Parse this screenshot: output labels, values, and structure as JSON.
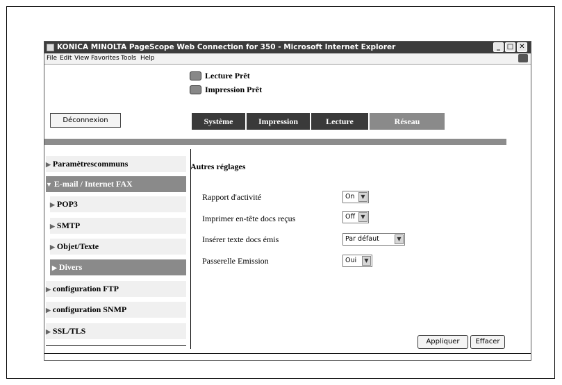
{
  "window": {
    "title": "KONICA MINOLTA PageScope Web Connection for 350 - Microsoft Internet Explorer",
    "controls": {
      "minimize": "_",
      "maximize": "□",
      "close": "✕"
    }
  },
  "menu": [
    "File",
    "Edit",
    "View",
    "Favorites",
    "Tools",
    "Help"
  ],
  "status": {
    "scan": "Lecture Prêt",
    "print": "Impression Prêt"
  },
  "logout_label": "Déconnexion",
  "tabs": [
    {
      "label": "Système",
      "active": true
    },
    {
      "label": "Impression",
      "active": true
    },
    {
      "label": "Lecture",
      "active": true
    },
    {
      "label": "Réseau",
      "active": false
    }
  ],
  "sidebar": {
    "items": [
      {
        "label": "Paramètrescommuns",
        "arrow": "▶"
      },
      {
        "label": "E-mail / Internet FAX",
        "arrow": "▼"
      },
      {
        "label": "POP3",
        "arrow": "▶"
      },
      {
        "label": "SMTP",
        "arrow": "▶"
      },
      {
        "label": "Objet/Texte",
        "arrow": "▶"
      },
      {
        "label": "Divers",
        "arrow": "▶"
      },
      {
        "label": "configuration FTP",
        "arrow": "▶"
      },
      {
        "label": "configuration SNMP",
        "arrow": "▶"
      },
      {
        "label": "SSL/TLS",
        "arrow": "▶"
      }
    ]
  },
  "main": {
    "section_title": "Autres réglages",
    "fields": [
      {
        "label": "Rapport d'activité",
        "value": "On"
      },
      {
        "label": "Imprimer en-tête docs reçus",
        "value": "Off"
      },
      {
        "label": "Insérer texte docs émis",
        "value": "Par défaut"
      },
      {
        "label": "Passerelle Emission",
        "value": "Oui"
      }
    ],
    "buttons": {
      "apply": "Appliquer",
      "clear": "Effacer"
    }
  }
}
